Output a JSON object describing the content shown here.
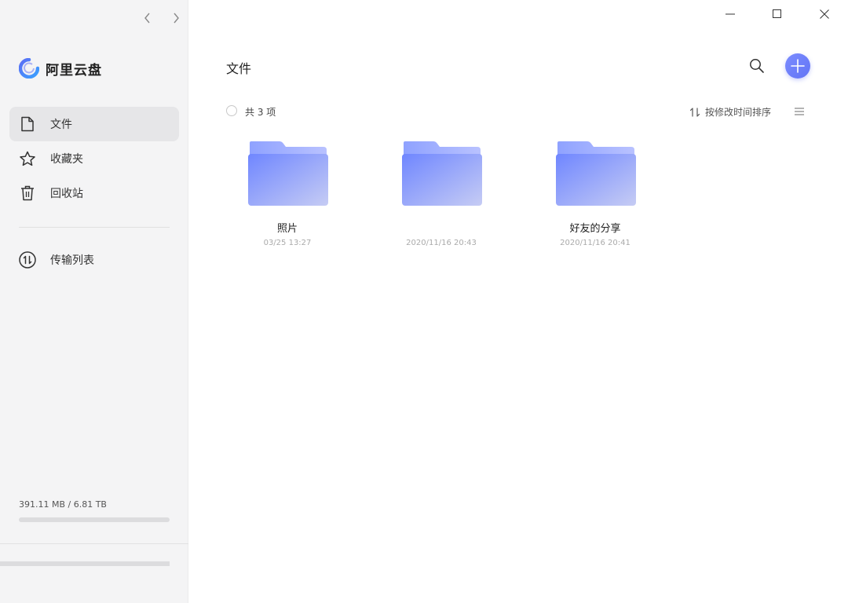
{
  "app": {
    "name": "阿里云盘",
    "brand_color": "#637dff"
  },
  "sidebar": {
    "items": [
      {
        "label": "文件",
        "icon": "file-icon",
        "active": true
      },
      {
        "label": "收藏夹",
        "icon": "star-icon",
        "active": false
      },
      {
        "label": "回收站",
        "icon": "trash-icon",
        "active": false
      }
    ],
    "transfer": {
      "label": "传输列表",
      "icon": "transfer-icon"
    },
    "storage": {
      "text": "391.11 MB / 6.81 TB",
      "used_fraction": 0.0
    }
  },
  "main": {
    "title": "文件",
    "count_text": "共 3 项",
    "sort_label": "按修改时间排序",
    "files": [
      {
        "name": "照片",
        "time": "03/25 13:27"
      },
      {
        "name": "",
        "time": "2020/11/16 20:43"
      },
      {
        "name": "好友的分享",
        "time": "2020/11/16 20:41"
      }
    ]
  }
}
